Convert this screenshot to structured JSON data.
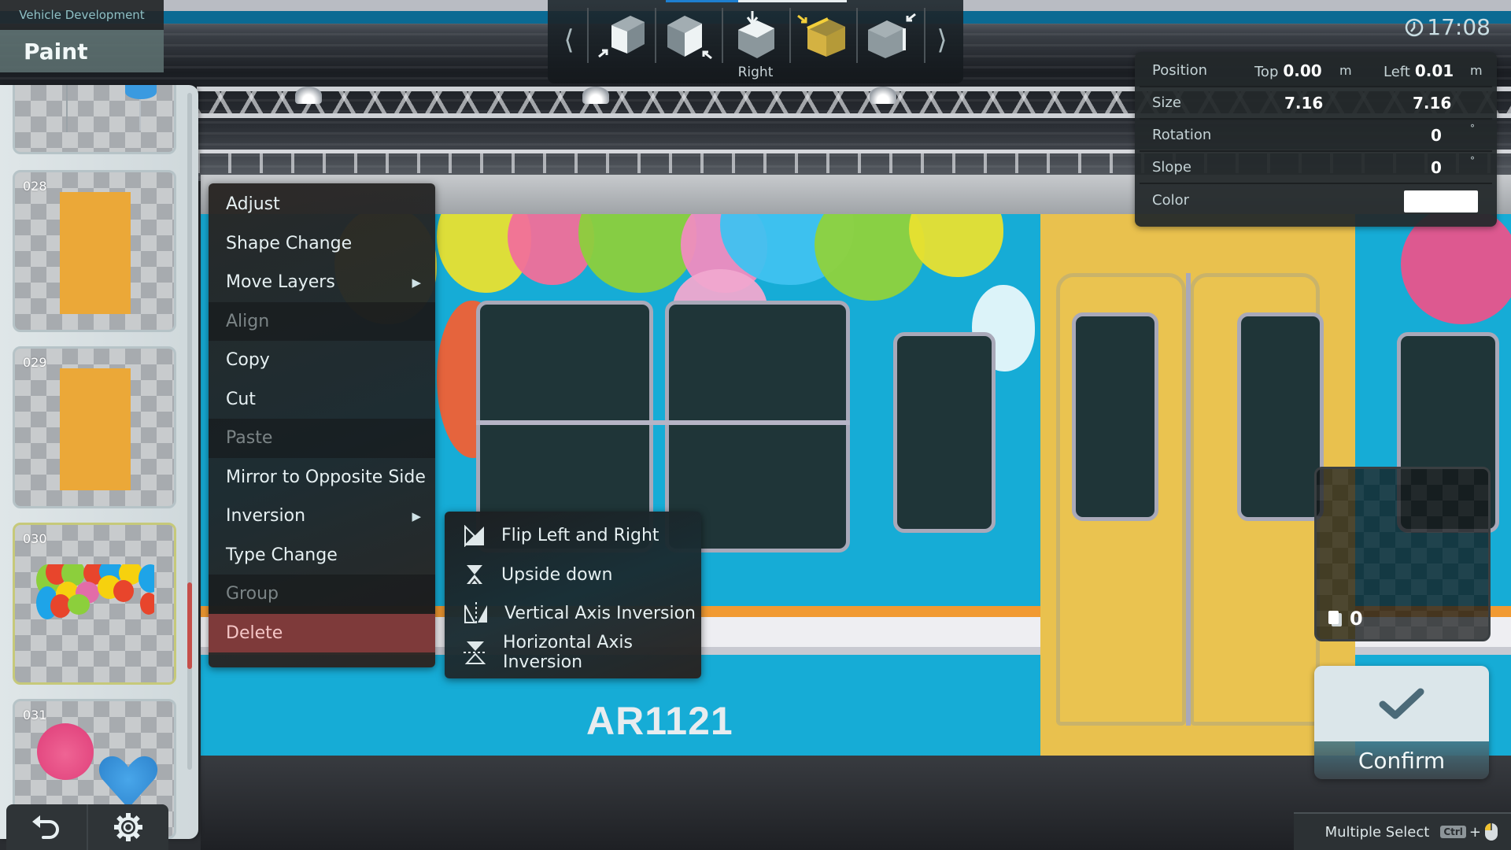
{
  "header": {
    "breadcrumb": "Vehicle Development",
    "title": "Paint"
  },
  "clock": {
    "icon": "clock-icon",
    "time": "17:08"
  },
  "camera_toolbar": {
    "prev_icon": "chevron-left-icon",
    "next_icon": "chevron-right-icon",
    "progress_percent": 40,
    "views": [
      {
        "name": "front-view",
        "icon": "cube-front-icon",
        "selected": false
      },
      {
        "name": "back-view",
        "icon": "cube-back-icon",
        "selected": false
      },
      {
        "name": "top-view",
        "icon": "cube-top-icon",
        "selected": false
      },
      {
        "name": "right-view",
        "icon": "cube-right-icon",
        "selected": true
      },
      {
        "name": "left-view",
        "icon": "cube-left-icon",
        "selected": false
      }
    ],
    "current_view_label": "Right"
  },
  "properties": {
    "position": {
      "label": "Position",
      "top_label": "Top",
      "top_value": "0.00",
      "top_unit": "m",
      "left_label": "Left",
      "left_value": "0.01",
      "left_unit": "m"
    },
    "size": {
      "label": "Size",
      "width": "7.16",
      "height": "7.16"
    },
    "rotation": {
      "label": "Rotation",
      "value": "0",
      "unit": "°"
    },
    "slope": {
      "label": "Slope",
      "value": "0",
      "unit": "°"
    },
    "color": {
      "label": "Color",
      "value": "#ffffff"
    }
  },
  "layers": {
    "items": [
      {
        "number": "",
        "content": "balloon-strings"
      },
      {
        "number": "028",
        "content": "orange-rectangle"
      },
      {
        "number": "029",
        "content": "orange-rectangle"
      },
      {
        "number": "030",
        "content": "balloon-cluster",
        "selected": true
      },
      {
        "number": "031",
        "content": "pink-and-blue-balloons"
      }
    ],
    "tools": [
      {
        "name": "undo",
        "icon": "undo-icon"
      },
      {
        "name": "settings",
        "icon": "gear-icon"
      }
    ]
  },
  "context_menu": {
    "items": [
      {
        "label": "Adjust",
        "state": "enabled"
      },
      {
        "label": "Shape Change",
        "state": "enabled"
      },
      {
        "label": "Move Layers",
        "state": "enabled",
        "submenu": true
      },
      {
        "label": "Align",
        "state": "disabled"
      },
      {
        "label": "Copy",
        "state": "enabled"
      },
      {
        "label": "Cut",
        "state": "enabled"
      },
      {
        "label": "Paste",
        "state": "disabled"
      },
      {
        "label": "Mirror to Opposite Side",
        "state": "enabled"
      },
      {
        "label": "Inversion",
        "state": "enabled",
        "submenu": true
      },
      {
        "label": "Type Change",
        "state": "enabled"
      },
      {
        "label": "Group",
        "state": "disabled"
      },
      {
        "label": "Delete",
        "state": "danger"
      }
    ],
    "submenu_arrow": "▶"
  },
  "inversion_submenu": {
    "items": [
      {
        "label": "Flip Left and Right",
        "icon": "flip-horizontal-icon"
      },
      {
        "label": "Upside down",
        "icon": "flip-vertical-icon"
      },
      {
        "label": "Vertical Axis Inversion",
        "icon": "vertical-axis-icon"
      },
      {
        "label": "Horizontal Axis Inversion",
        "icon": "horizontal-axis-icon"
      }
    ]
  },
  "vehicle": {
    "car_number": "AR1121",
    "colors": {
      "body": "#16acd6",
      "door_panel": "#e9c14e",
      "window": "#1f3538",
      "stripe_orange": "#f19a32",
      "stripe_white": "#eeeef2"
    }
  },
  "selection_counter": {
    "icon": "pages-icon",
    "count": "0"
  },
  "confirm": {
    "icon": "checkmark-icon",
    "label": "Confirm"
  },
  "hint": {
    "label": "Multiple Select",
    "key": "Ctrl",
    "plus": "+",
    "mouse_icon": "mouse-left-click-icon"
  }
}
